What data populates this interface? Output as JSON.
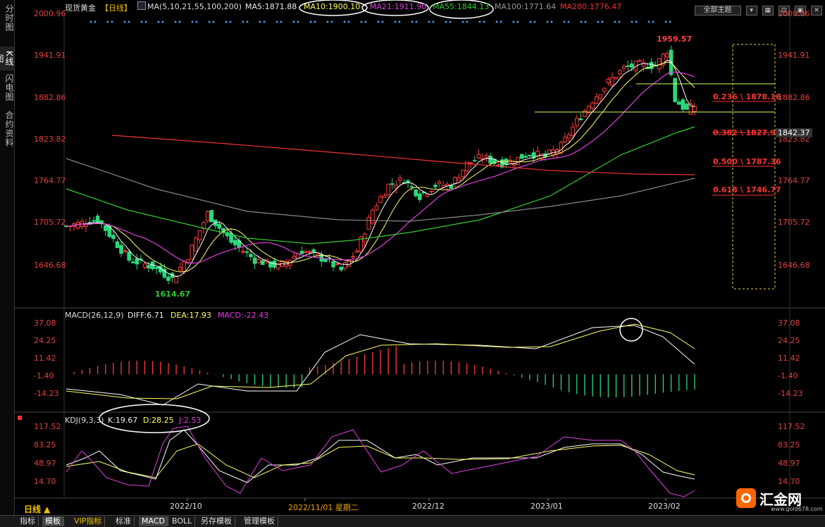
{
  "sidebar": {
    "tabs": [
      {
        "label": "分时图",
        "active": false
      },
      {
        "label": "K线图",
        "active": true
      },
      {
        "label": "闪电图",
        "active": false
      },
      {
        "label": "合约资料",
        "active": false
      }
    ]
  },
  "header": {
    "instrument": "现货黄金",
    "period_tag": "【日线】",
    "ma_group": "MA(5,10,21,55,100,200)",
    "ma5": "MA5:1871.88",
    "ma10": "MA10:1900.10",
    "ma21": "MA21:1911.90",
    "ma55": "MA55:1844.13",
    "ma100": "MA100:1771.64",
    "ma200": "MA200:1776.47",
    "theme_select": "全部主题"
  },
  "price_axis": {
    "ticks": [
      "2000.96",
      "1941.91",
      "1882.86",
      "1823.82",
      "1764.77",
      "1705.72",
      "1646.68"
    ],
    "current_price": "1842.37"
  },
  "annotations": {
    "high": "1959.57",
    "low": "1614.67",
    "fib": [
      "0.236 \\ 1878.16",
      "0.382 \\ 1827.94",
      "0.500 \\ 1787.36",
      "0.618 \\ 1746.77"
    ]
  },
  "macd": {
    "title": "MACD(26,12,9)",
    "diff": "DIFF:6.71",
    "dea": "DEA:17.93",
    "macd": "MACD:-22.43",
    "ticks": [
      "37.08",
      "24.25",
      "11.42",
      "-1.40",
      "-14.23"
    ]
  },
  "kdj": {
    "title": "KDJ(9,3,3)",
    "k": "K:19.67",
    "d": "D:28.25",
    "j": "J:2.53",
    "ticks": [
      "117.52",
      "83.25",
      "48.97",
      "14.70"
    ]
  },
  "time_axis": {
    "labels": [
      "2022/10",
      "2022/11/01 星期二",
      "2022/12",
      "2023/01",
      "2023/02"
    ]
  },
  "bottom_bar": {
    "period": "日线 ▲",
    "tabs": [
      "指标",
      "模板",
      "VIP指标",
      "标准",
      "MACD",
      "BOLL",
      "另存模板",
      "管理模板"
    ],
    "selected": [
      "模板",
      "MACD"
    ]
  },
  "brand": {
    "name": "汇金网",
    "url": "www.gold678.com"
  },
  "colors": {
    "up": "#ff3b3b",
    "down": "#2bd87a",
    "ma5": "#ffffff",
    "ma10": "#ffff66",
    "ma21": "#e040e0",
    "ma55": "#33cc33",
    "ma100": "#888888",
    "ma200": "#e33"
  }
}
